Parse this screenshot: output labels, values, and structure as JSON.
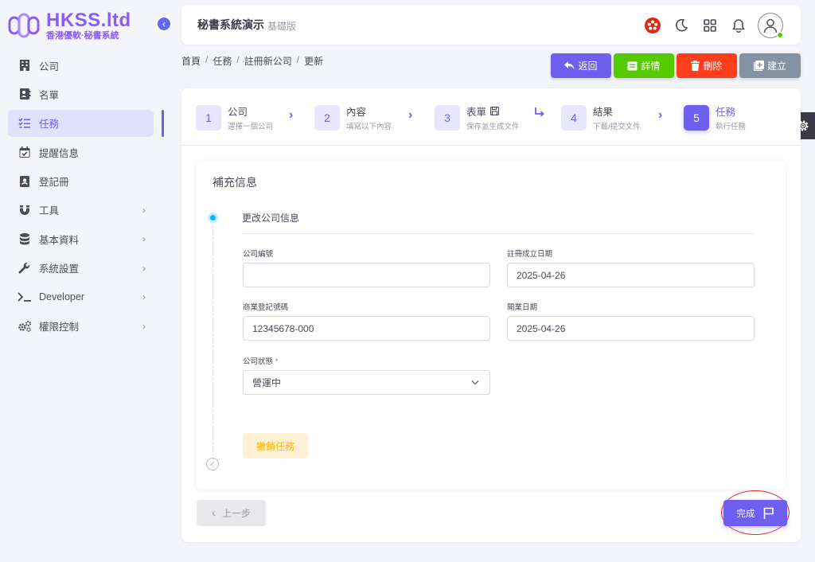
{
  "logo": {
    "title": "HKSS.ltd",
    "subtitle": "香港優軟·秘書系統"
  },
  "sidebar": {
    "items": [
      {
        "label": "公司",
        "icon": "building-icon"
      },
      {
        "label": "名單",
        "icon": "contact-card-icon"
      },
      {
        "label": "任務",
        "icon": "checklist-icon",
        "active": true
      },
      {
        "label": "提醒信息",
        "icon": "calendar-check-icon"
      },
      {
        "label": "登記冊",
        "icon": "register-book-icon"
      },
      {
        "label": "工具",
        "icon": "magnet-icon",
        "expandable": true
      },
      {
        "label": "基本資料",
        "icon": "database-icon",
        "expandable": true
      },
      {
        "label": "系統設置",
        "icon": "wrench-icon",
        "expandable": true
      },
      {
        "label": "Developer",
        "icon": "terminal-icon",
        "expandable": true
      },
      {
        "label": "權限控制",
        "icon": "cogs-icon",
        "expandable": true
      }
    ]
  },
  "header": {
    "title": "秘書系統演示",
    "subtitle": "基礎版"
  },
  "breadcrumb": [
    "首頁",
    "任務",
    "註冊新公司",
    "更新"
  ],
  "actions": [
    {
      "label": "返回",
      "icon": "reply-icon",
      "color": "#6f5ff0"
    },
    {
      "label": "詳情",
      "icon": "details-icon",
      "color": "#56ca00"
    },
    {
      "label": "刪除",
      "icon": "trash-icon",
      "color": "#ff3e1d"
    },
    {
      "label": "建立",
      "icon": "plus-square-icon",
      "color": "#8592a3"
    }
  ],
  "steps": [
    {
      "num": "1",
      "title": "公司",
      "desc": "選擇一個公司"
    },
    {
      "num": "2",
      "title": "內容",
      "desc": "填寫以下內容"
    },
    {
      "num": "3",
      "title": "表單",
      "desc": "保存並生成文件"
    },
    {
      "num": "4",
      "title": "結果",
      "desc": "下載/提交文件"
    },
    {
      "num": "5",
      "title": "任務",
      "desc": "執行任務",
      "active": true
    }
  ],
  "panel": {
    "title": "補充信息",
    "section_title": "更改公司信息",
    "fields": {
      "company_no": {
        "label": "公司編號",
        "value": ""
      },
      "reg_date": {
        "label": "註冊成立日期",
        "value": "2025-04-26"
      },
      "br_no": {
        "label": "商業登記號碼",
        "value": "12345678-000"
      },
      "open_date": {
        "label": "開業日期",
        "value": "2025-04-26"
      },
      "status": {
        "label": "公司狀態",
        "required": "*",
        "value": "營運中"
      }
    },
    "revoke_label": "撤銷任務"
  },
  "footer": {
    "prev_label": "上一步",
    "done_label": "完成"
  },
  "colors": {
    "primary": "#6f5ff0",
    "success": "#56ca00",
    "danger": "#ff3e1d",
    "secondary": "#8592a3",
    "warning": "#ffb400",
    "info": "#16b1ff"
  }
}
